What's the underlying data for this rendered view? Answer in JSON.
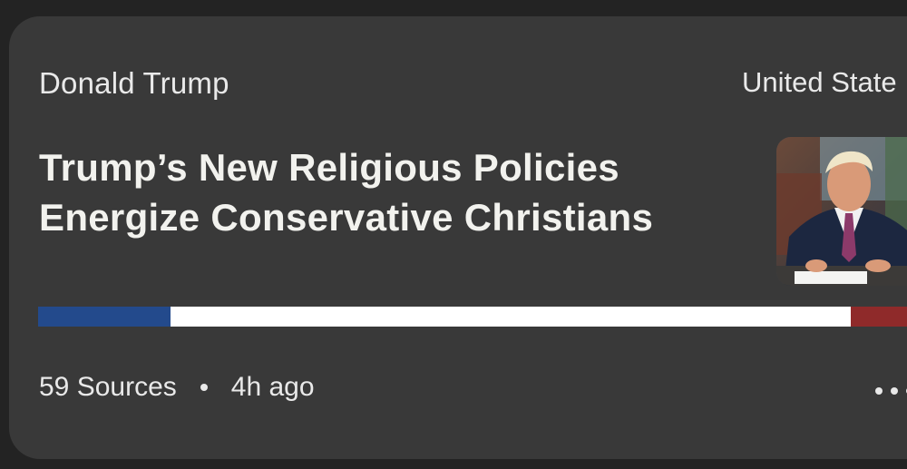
{
  "card": {
    "topic": "Donald Trump",
    "region": "United State",
    "headline_line1": "Trump’s New Religious Policies",
    "headline_line2": "Energize Conservative Christians",
    "sources": "59 Sources",
    "time": "4h ago",
    "thumbnail_icon": "news-photo-icon",
    "more_icon": "more-options-icon"
  },
  "bias": {
    "left_fraction": 0.146,
    "center_fraction": 0.75,
    "right_fraction": 0.104,
    "colors": {
      "left": "#234a8c",
      "center": "#ffffff",
      "right": "#8f2a2a"
    }
  }
}
